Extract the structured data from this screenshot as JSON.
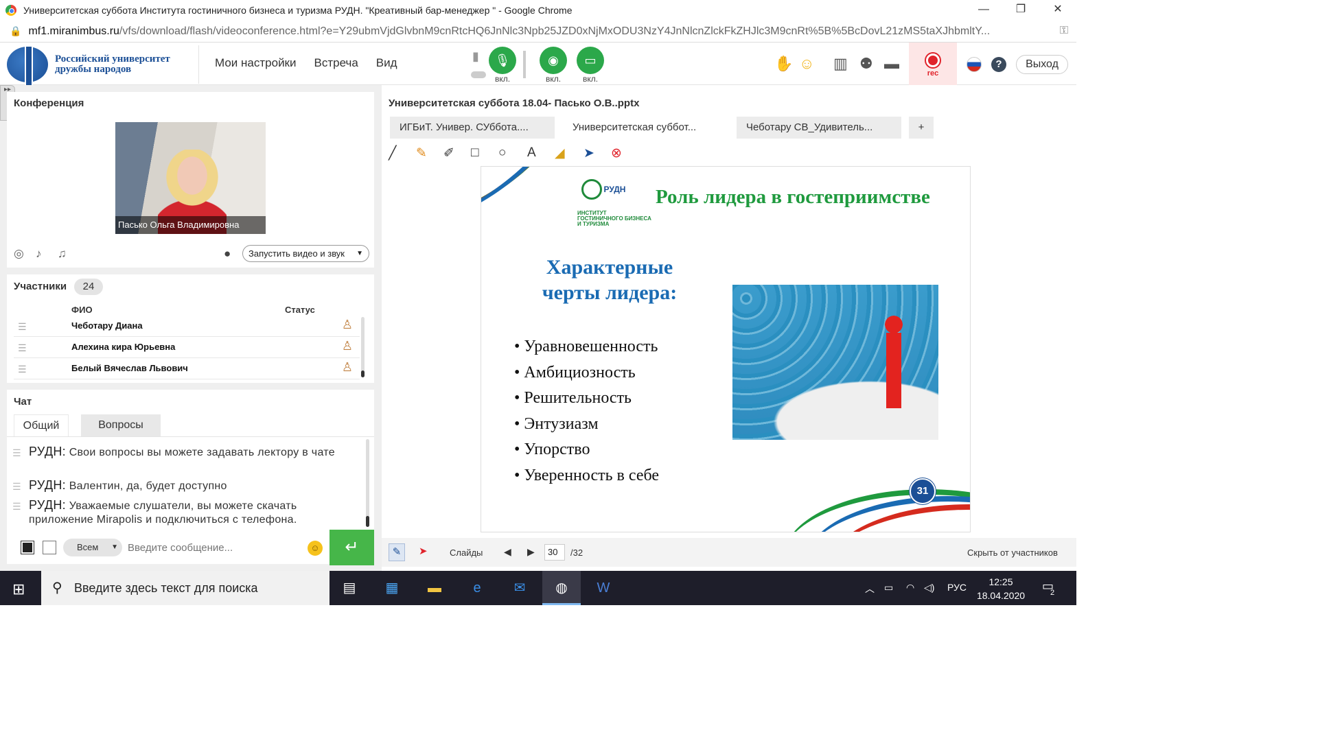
{
  "browser": {
    "title": "Университетская суббота Института гостиничного бизнеса и туризма РУДН. \"Креативный бар-менеджер \" - Google Chrome",
    "url_domain": "mf1.miranimbus.ru",
    "url_path": "/vfs/download/flash/videoconference.html?e=Y29ubmVjdGlvbnM9cnRtcHQ6JnNlc3Npb25JZD0xNjMxODU3NzY4JnNlcnZlckFkZHJlc3M9cnRt%5B%5BcDovL21zMS5taXJhbmltY..."
  },
  "header": {
    "logo_line1": "Российский университет",
    "logo_line2": "дружбы народов",
    "menu": [
      "Мои настройки",
      "Встреча",
      "Вид"
    ],
    "mic_label": "вкл.",
    "camera_label": "вкл.",
    "screen_label": "вкл.",
    "rec_label": "rec",
    "exit_label": "Выход"
  },
  "conference": {
    "title": "Конференция",
    "speaker_name": "Пасько Ольга Владимировна",
    "start_button": "Запустить видео и звук"
  },
  "participants": {
    "title": "Участники",
    "count": "24",
    "col_name": "ФИО",
    "col_status": "Статус",
    "rows": [
      "Чеботару  Диана",
      "Алехина  кира  Юрьевна",
      "Белый Вячеслав  Львович"
    ]
  },
  "chat": {
    "title": "Чат",
    "tabs": [
      "Общий",
      "Вопросы"
    ],
    "messages": [
      {
        "author": "РУДН:",
        "text": "Свои вопросы вы можете задавать лектору в чате"
      },
      {
        "author": "РУДН:",
        "text": "Валентин, да, будет доступно"
      },
      {
        "author": "РУДН:",
        "text": "Уважаемые слушатели,  вы можете скачать приложение Mirapolis и подключиться с телефона."
      }
    ],
    "recipient": "Всем",
    "input_placeholder": "Введите сообщение..."
  },
  "presentation": {
    "file_title": "Университетская суббота 18.04- Пасько О.В..pptx",
    "tabs": [
      "ИГБиТ. Универ. СУббота....",
      "Университетская суббот...",
      "Чеботару СВ_Удивитель...",
      "+"
    ],
    "slide": {
      "logo_text": "РУДН",
      "institute": "ИНСТИТУТ ГОСТИНИЧНОГО БИЗНЕСА И ТУРИЗМА",
      "heading": "Роль лидера в гостеприимстве",
      "subheading_line1": "Характерные",
      "subheading_line2": "черты лидера:",
      "bullets": [
        "Уравновешенность",
        "Амбициозность",
        "Решительность",
        "Энтузиазм",
        "Упорство",
        "Уверенность в себе"
      ],
      "page_badge": "31"
    },
    "slides_label": "Слайды",
    "current_page": "30",
    "total_pages": "/32",
    "hide_label": "Скрыть от участников"
  },
  "taskbar": {
    "search_placeholder": "Введите здесь текст для поиска",
    "lang": "РУС",
    "time": "12:25",
    "date": "18.04.2020",
    "notif_count": "2"
  }
}
